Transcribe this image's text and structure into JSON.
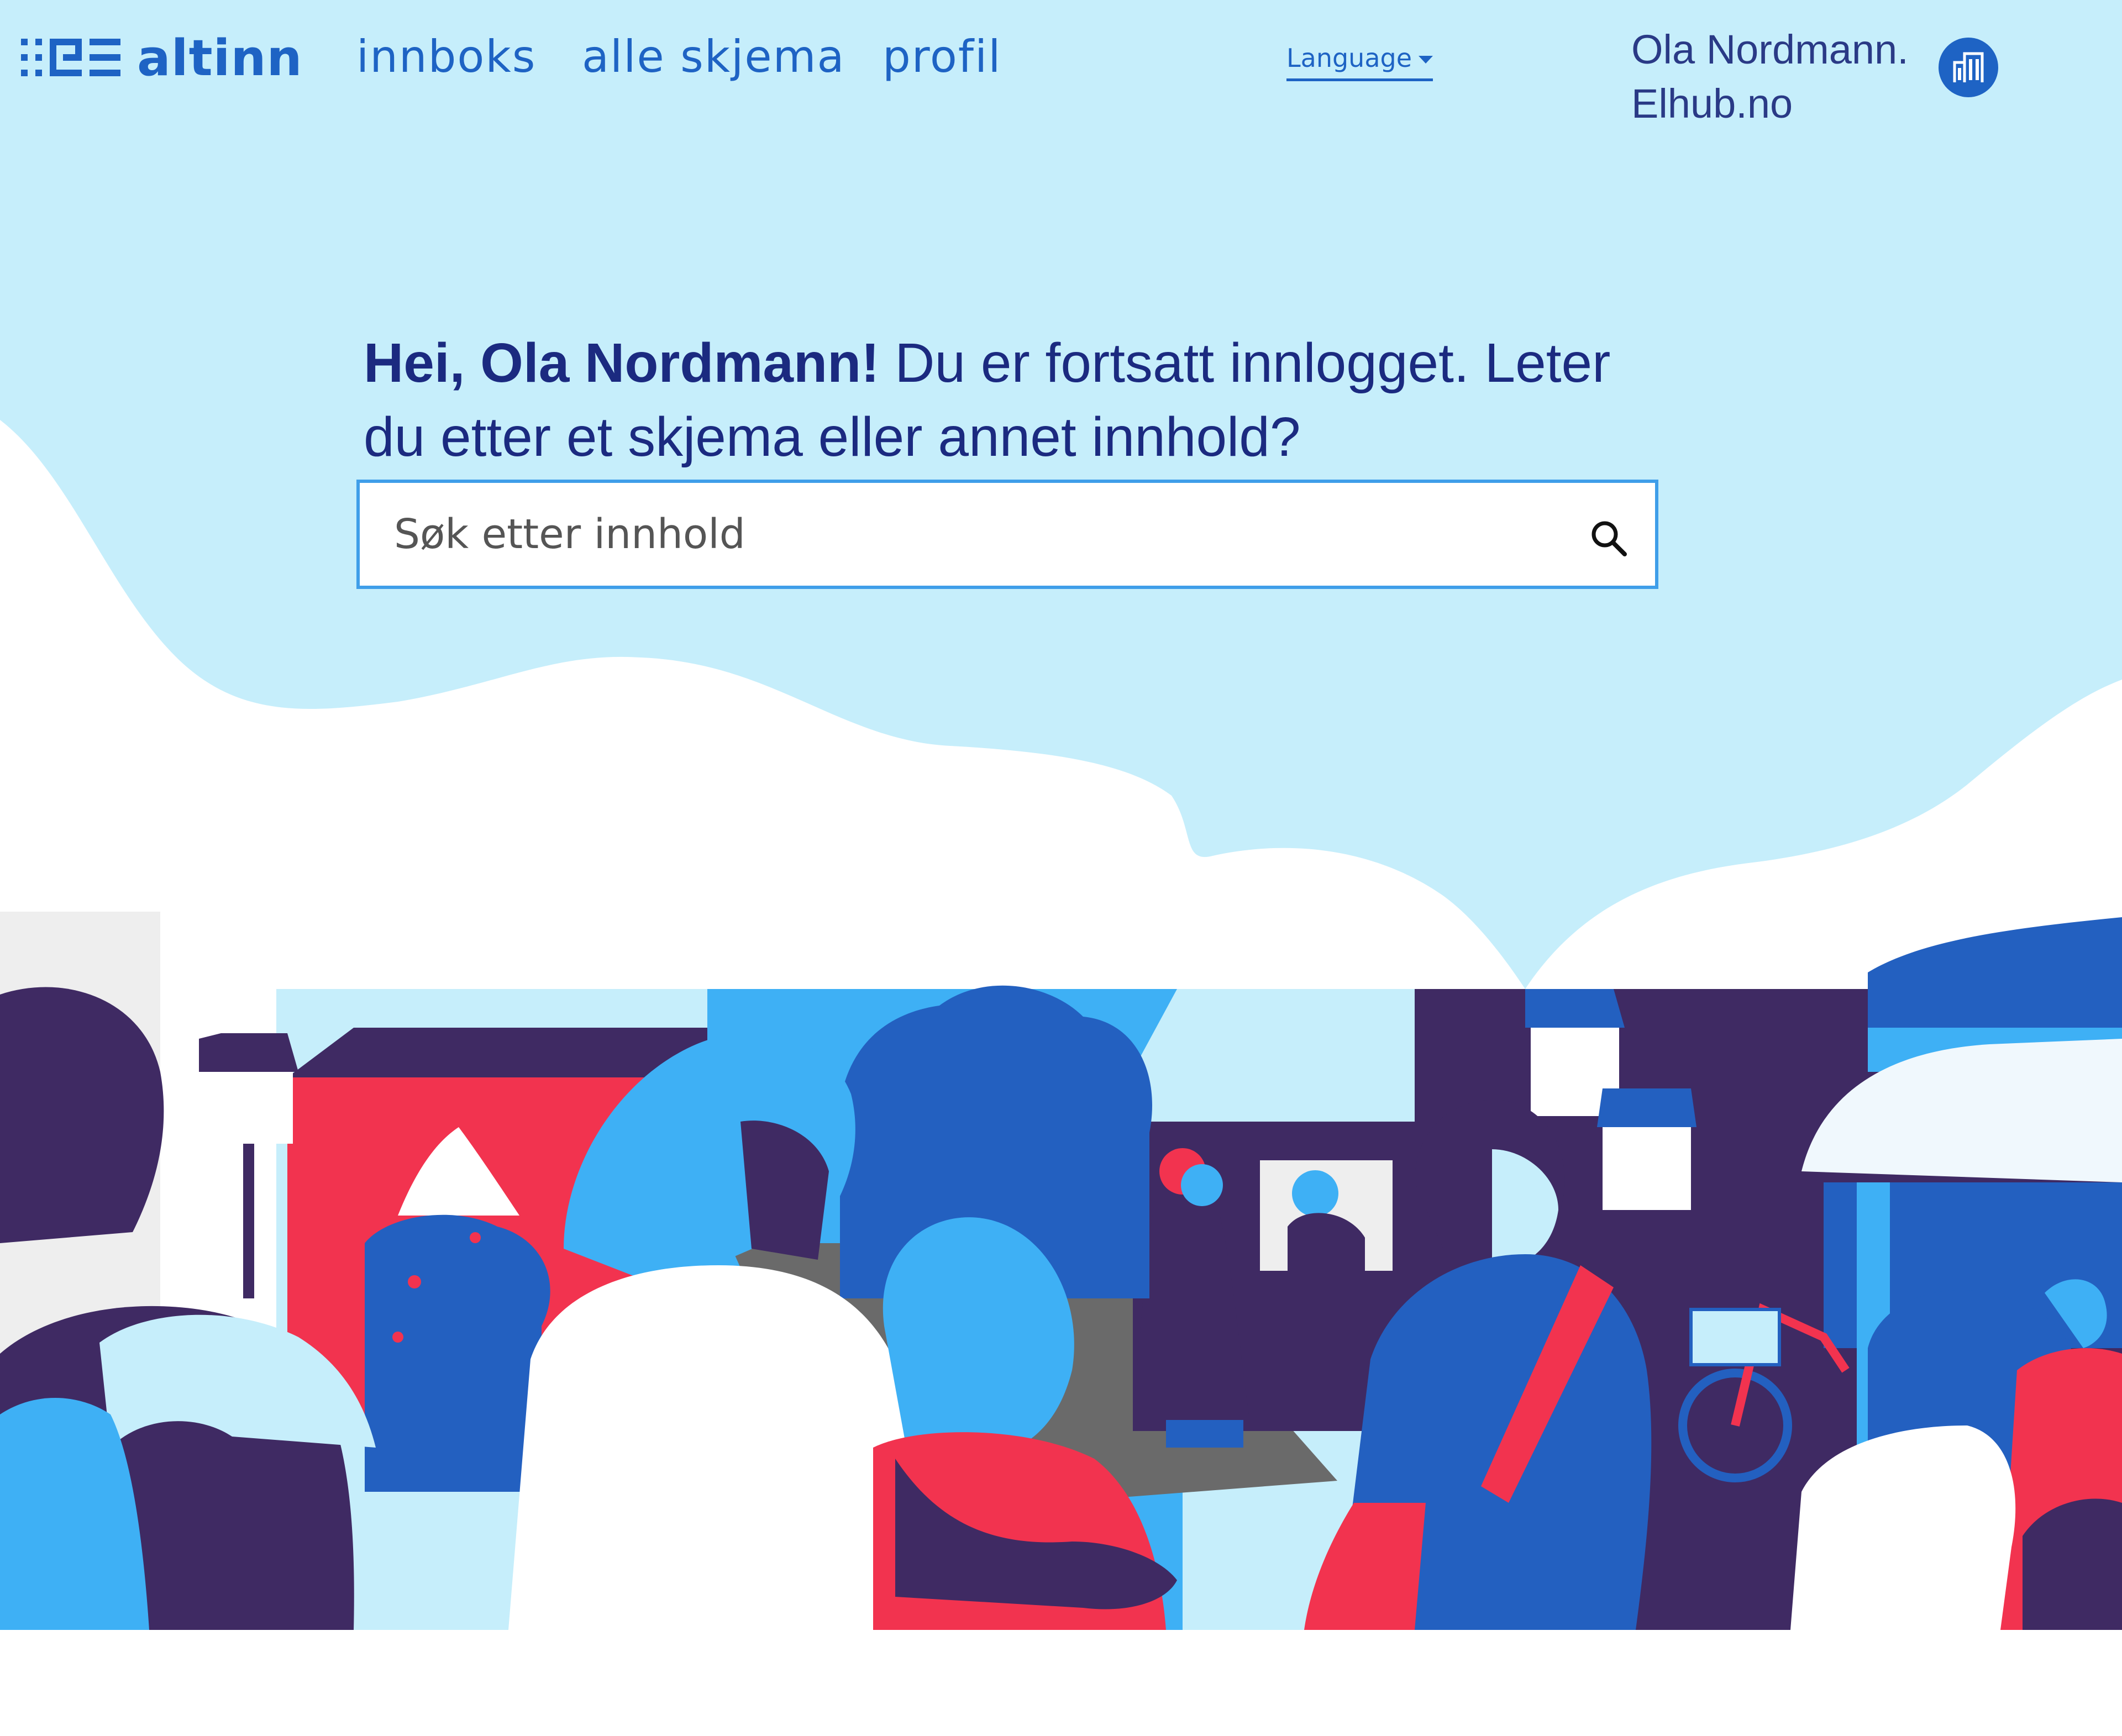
{
  "header": {
    "logo_text": "altinn",
    "nav": [
      {
        "label": "innboks"
      },
      {
        "label": "alle skjema"
      },
      {
        "label": "profil"
      }
    ],
    "language_label": "Language",
    "user": {
      "name": "Ola Nordmann.",
      "org": "Elhub.no",
      "avatar_icon": "building-icon"
    }
  },
  "hero": {
    "greeting_bold": "Hei, Ola Nordmann!",
    "greeting_rest": " Du er fortsatt innlogget. Leter du etter et skjema eller annet innhold?",
    "search_placeholder": "Søk etter innhold",
    "search_icon": "search-icon"
  },
  "colors": {
    "sky": "#c6eefb",
    "brand_blue": "#1e63c4",
    "heading_navy": "#1b2a80",
    "light_blue": "#3eb0f5",
    "dark_purple": "#3f2a63",
    "red": "#f2334f"
  }
}
